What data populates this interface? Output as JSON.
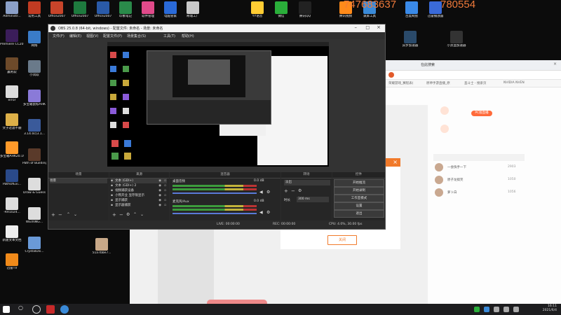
{
  "desktop": {
    "icons_left": [
      {
        "label": "Administr...",
        "color": "#8ba0c8"
      },
      {
        "label": "Premiere CC2019",
        "color": "#3b1d5a"
      },
      {
        "label": "赢利软",
        "color": "#6d4a2a"
      },
      {
        "label": "error",
        "color": "#dddddd"
      },
      {
        "label": "文子过滤不顺",
        "color": "#ddb048"
      },
      {
        "label": "多宝箱AHK20.19...",
        "color": "#ff9a2a"
      },
      {
        "label": "PathOfExi...",
        "color": "#2a4a8a"
      },
      {
        "label": "-RR1024...",
        "color": "#dddddd"
      },
      {
        "label": "新建文本文档",
        "color": "#eeeeee"
      },
      {
        "label": "迅雷TV",
        "color": "#f08a1a"
      }
    ],
    "icons_col2": [
      {
        "label": "常用工具",
        "color": "#c23b22"
      },
      {
        "label": "网络",
        "color": "#3a7cc8"
      },
      {
        "label": "小试软",
        "color": "#6a7a8a"
      },
      {
        "label": "多宝箱鼠标AHK",
        "color": "#8a7ad8"
      },
      {
        "label": "3.14.0c(3.1...",
        "color": "#3a5a9a"
      },
      {
        "label": "Path of Building",
        "color": "#5a3a2a"
      },
      {
        "label": "Draw & Guess",
        "color": "#dddddd"
      },
      {
        "label": "WEIXING...",
        "color": "#dddddd"
      },
      {
        "label": "CrystalDis...",
        "color": "#6a9ad8"
      }
    ],
    "icons_top": [
      {
        "label": "Office2007",
        "color": "#c8442a"
      },
      {
        "label": "Office2007",
        "color": "#1e7a3e"
      },
      {
        "label": "Office2007",
        "color": "#2a5aa8"
      },
      {
        "label": "印象笔记",
        "color": "#2a8a4a"
      },
      {
        "label": "软件管理",
        "color": "#e04a8a"
      },
      {
        "label": "电脑管家",
        "color": "#2a6ad8"
      },
      {
        "label": "奇瑞工厂",
        "color": "#c8c8c8"
      },
      {
        "label": "YY语音",
        "color": "#ffcc33"
      },
      {
        "label": "微信",
        "color": "#2aae3a"
      },
      {
        "label": "腾讯QQ",
        "color": "#222222"
      },
      {
        "label": "腾讯视频",
        "color": "#ff8a1a"
      },
      {
        "label": "录屏工具",
        "color": "#3a8ad8"
      },
      {
        "label": "百度网盘",
        "color": "#3a8ae8"
      },
      {
        "label": "迅雷播放器",
        "color": "#3a6ad8"
      },
      {
        "label": "异步加速器",
        "color": "#2a4a6a"
      },
      {
        "label": "小黑盒加速器",
        "color": "#333333"
      }
    ],
    "file_center": {
      "label": "51a7bbe7...",
      "color": "#c8a888"
    },
    "overlay_number_1": "747683637",
    "overlay_number_2": "780554"
  },
  "browser": {
    "tab_title": "在此搜索",
    "bookmarks": [
      "荣耀游戏_赛程表(",
      "原神手游直播_原",
      "圣斗士 - 搜索页",
      "NVIDIA NVEN"
    ],
    "side_label": "PC版直播",
    "list_items": [
      {
        "name": "一会快手一下",
        "count": "2903"
      },
      {
        "name": "原子龙搞笑",
        "count": "1050"
      },
      {
        "name": "萝卜白",
        "count": "1056"
      }
    ]
  },
  "dialog": {
    "ok_label": "关闭"
  },
  "obs": {
    "title": "OBS 25.0.8 (64-bit, windows) - 配置文件: 未命名 - 场景: 未命名",
    "menu": [
      "文件(F)",
      "编辑(E)",
      "视图(V)",
      "配置文件(P)",
      "场景集合(S)",
      "工具(T)",
      "帮助(H)"
    ],
    "docks": {
      "scenes": "场景",
      "sources": "来源",
      "mixer": "混音器",
      "transitions": "转场",
      "controls": "控件"
    },
    "scene_item": "场景",
    "sources": [
      "文本 (GDI+)",
      "文本 (GDI+) 2",
      "视频捕获设备",
      "小熊开业 显存限显示",
      "显示捕获",
      "显示器捕获"
    ],
    "mixer": {
      "ch1": "桌面音频",
      "ch1_db": "0.0 dB",
      "ch2": "麦克风/Aux",
      "ch2_db": "0.0 dB"
    },
    "transition": {
      "type": "淡出",
      "duration_label": "时长",
      "duration_value": "300 ms"
    },
    "controls": [
      "开始推流",
      "开始录制",
      "工作室模式",
      "设置",
      "退出"
    ],
    "status": {
      "live": "LIVE: 00:00:00",
      "rec": "REC: 00:00:00",
      "cpu": "CPU: 4.0%, 30.00 fps"
    }
  },
  "taskbar": {
    "time": "16:11",
    "date": "2021/6/4"
  }
}
